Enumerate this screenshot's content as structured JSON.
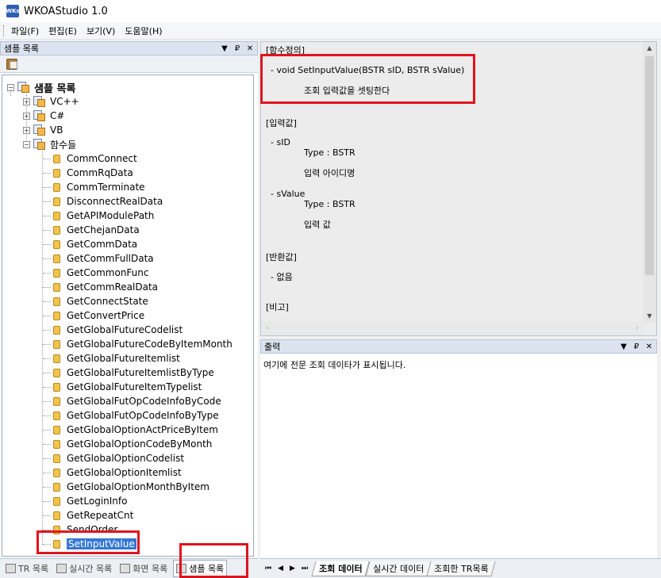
{
  "app": {
    "title": "WKOAStudio 1.0",
    "icon_text": "WKs"
  },
  "menu": [
    {
      "label": "파일(F)"
    },
    {
      "label": "편집(E)"
    },
    {
      "label": "보기(V)"
    },
    {
      "label": "도움말(H)"
    }
  ],
  "left_panel": {
    "title": "샘플 목록",
    "controls": [
      "▼",
      "₽",
      "✕"
    ],
    "root_label": "샘플 목록",
    "folders": [
      {
        "label": "VC++",
        "expanded": false
      },
      {
        "label": "C#",
        "expanded": false
      },
      {
        "label": "VB",
        "expanded": false
      },
      {
        "label": "함수들",
        "expanded": true
      }
    ],
    "functions": [
      "CommConnect",
      "CommRqData",
      "CommTerminate",
      "DisconnectRealData",
      "GetAPIModulePath",
      "GetChejanData",
      "GetCommData",
      "GetCommFullData",
      "GetCommonFunc",
      "GetCommRealData",
      "GetConnectState",
      "GetConvertPrice",
      "GetGlobalFutureCodelist",
      "GetGlobalFutureCodeByItemMonth",
      "GetGlobalFutureItemlist",
      "GetGlobalFutureItemlistByType",
      "GetGlobalFutureItemTypelist",
      "GetGlobalFutOpCodeInfoByCode",
      "GetGlobalFutOpCodeInfoByType",
      "GetGlobalOptionActPriceByItem",
      "GetGlobalOptionCodeByMonth",
      "GetGlobalOptionCodelist",
      "GetGlobalOptionItemlist",
      "GetGlobalOptionMonthByItem",
      "GetLoginInfo",
      "GetRepeatCnt",
      "SendOrder",
      "SetInputValue"
    ],
    "selected": "SetInputValue",
    "bottom_tabs": [
      {
        "label": "TR 목록"
      },
      {
        "label": "실시간 목록"
      },
      {
        "label": "화면 목록"
      },
      {
        "label": "샘플 목록",
        "active": true
      }
    ]
  },
  "detail": {
    "lines": [
      "[함수정의]",
      "- void SetInputValue(BSTR sID, BSTR sValue)",
      "조회 입력값을 셋팅한다",
      "[입력값]",
      "- sID",
      "Type : BSTR",
      "입력 아이디명",
      "- sValue",
      "Type : BSTR",
      "입력 값",
      "[반환값]",
      "- 없음",
      "[비고]"
    ]
  },
  "output": {
    "title": "출력",
    "controls": [
      "▼",
      "₽",
      "✕"
    ],
    "message": "여기에 전문 조회 데이타가 표시됩니다.",
    "nav": [
      "⏮",
      "◀",
      "▶",
      "⏭"
    ],
    "tabs": [
      {
        "label": "조회 데이터",
        "active": true
      },
      {
        "label": "실시간 데이터"
      },
      {
        "label": "조회한 TR목록"
      }
    ]
  },
  "colors": {
    "highlight": "#e0141e",
    "selection": "#3478d4",
    "panel_header": "#dbe3ef"
  }
}
